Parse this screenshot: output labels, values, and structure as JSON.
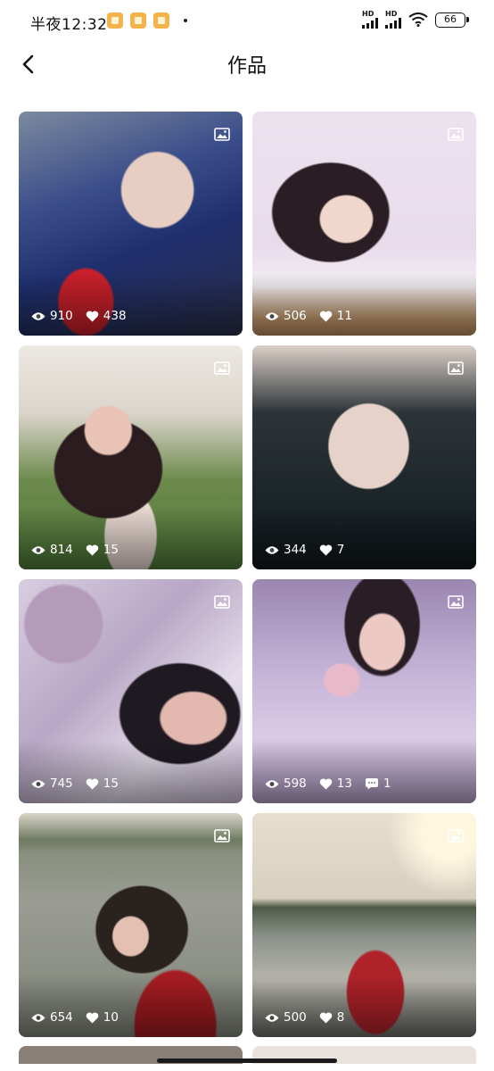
{
  "status_bar": {
    "time": "半夜12:32",
    "network_label": "HD",
    "battery": "66"
  },
  "header": {
    "title": "作品",
    "back_icon": "chevron-left-icon"
  },
  "works": [
    {
      "views": "910",
      "likes": "438",
      "comments": ""
    },
    {
      "views": "506",
      "likes": "11",
      "comments": ""
    },
    {
      "views": "814",
      "likes": "15",
      "comments": ""
    },
    {
      "views": "344",
      "likes": "7",
      "comments": ""
    },
    {
      "views": "745",
      "likes": "15",
      "comments": ""
    },
    {
      "views": "598",
      "likes": "13",
      "comments": "1"
    },
    {
      "views": "654",
      "likes": "10",
      "comments": ""
    },
    {
      "views": "500",
      "likes": "8",
      "comments": ""
    }
  ],
  "icons": {
    "views": "eye-icon",
    "likes": "heart-icon",
    "comments": "comment-icon",
    "type": "image-icon"
  }
}
